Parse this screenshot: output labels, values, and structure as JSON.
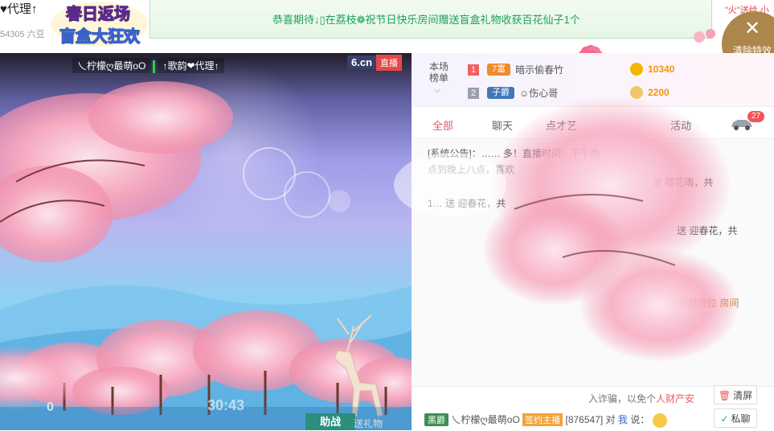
{
  "header": {
    "room_title": "♥代理↑",
    "room_id": "54305 六豆",
    "promo_logo_line1": "春日返场",
    "promo_logo_line2": "盲盒大狂欢",
    "marquee": "恭喜期待↓▯在荔枝❁祝节日快乐房间赠送盲盒礼物收获百花仙子1个",
    "fire_tag": "\"火\"送给 小",
    "clear_effect_label": "清除特效"
  },
  "video": {
    "anchor_tag_1": "乀柠檬ღ最萌oO",
    "anchor_tag_2": "↑歌韵❤代理↑",
    "brand": "6.cn",
    "live_label": "直播",
    "support_button": "助战",
    "gift_link": "送礼物",
    "viewer_count": "30:43",
    "bottom_left_text": "0"
  },
  "ranking": {
    "title": "本场\n榜单",
    "rows": [
      {
        "rank": "1",
        "badge": "7富",
        "name": "暗示偷春竹",
        "value": "10340",
        "rank_color": "#f35f5f",
        "badge_color": "#f08a2a"
      },
      {
        "rank": "2",
        "badge": "子爵",
        "name": "☺伤心哥",
        "value": "2200",
        "rank_color": "#9aa0ad",
        "badge_color": "#3f78b8"
      }
    ]
  },
  "tabs": {
    "items": [
      "全部",
      "聊天",
      "点才艺",
      "",
      "活动"
    ],
    "car_badge": "27"
  },
  "chat": {
    "lines": [
      {
        "text": "[系统公告]：…… 多！直播时间：下午两",
        "color": "#555"
      },
      {
        "text": "点到晚上八点，喜欢",
        "color": "#999"
      },
      {
        "text": "送 樱花雨，共",
        "color": "#555"
      },
      {
        "text": "1… 送 迎春花，共",
        "color": "#555"
      },
      {
        "text": "送 迎春花，共",
        "color": "#555"
      },
      {
        "text": "海哥荣登帝位 房间",
        "color": "#c47e1e"
      }
    ],
    "safety_note_prefix": "入诈骗，以免个",
    "safety_note_highlight": "人财产安",
    "input_vip": "黑爵",
    "input_name": "乀柠檬ღ最萌oO",
    "input_anchor_tag": "签约主播",
    "input_id": "[876547]",
    "input_to": "对",
    "input_me": "我",
    "input_say": "说：",
    "clear_screen": "清屏",
    "private_chat": "私聊"
  },
  "colors": {
    "accent_green": "#1aa05a",
    "accent_red": "#e85c5c",
    "clear_effect_bg": "#ad864c"
  }
}
